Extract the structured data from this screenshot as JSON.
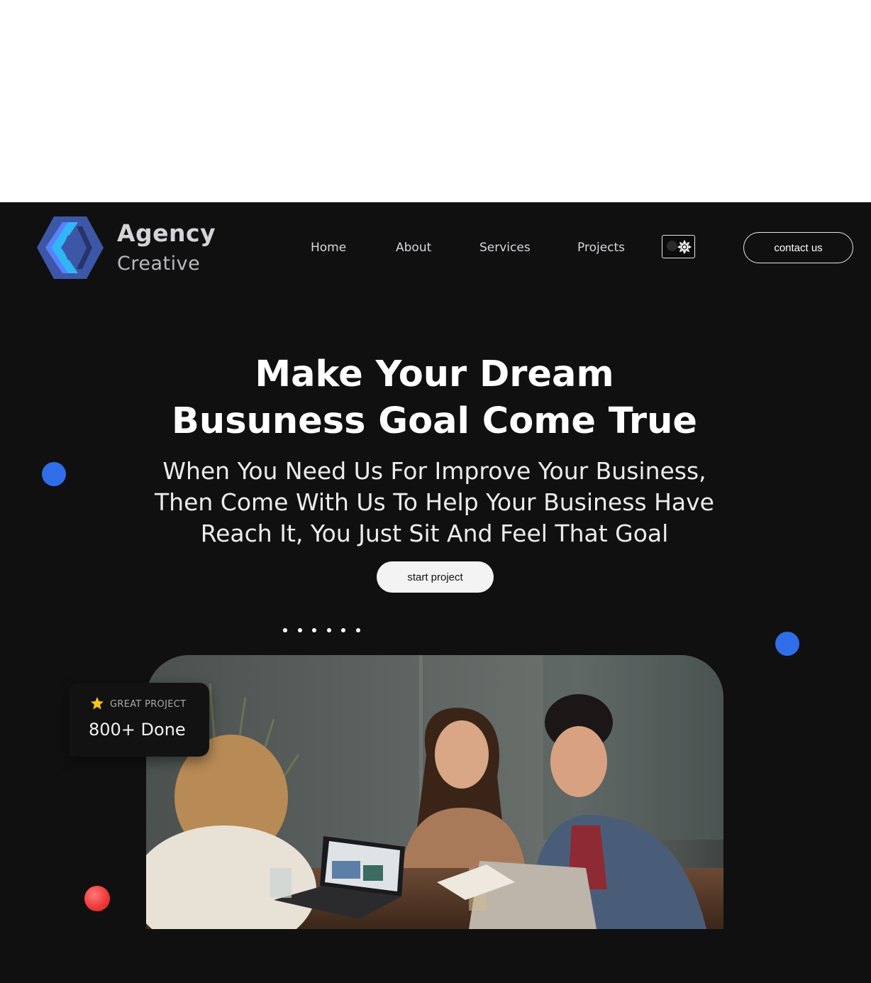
{
  "brand": {
    "title": "Agency",
    "subtitle": "Creative"
  },
  "nav": {
    "items": [
      {
        "label": "Home"
      },
      {
        "label": "About"
      },
      {
        "label": "Services"
      },
      {
        "label": "Projects"
      }
    ],
    "theme_toggle_icons": [
      "moon-icon",
      "sun-icon"
    ],
    "contact_label": "contact us"
  },
  "hero": {
    "title_line1": "Make Your Dream",
    "title_line2": "Busuness Goal Come True",
    "subtitle_line1": "When You Need Us For Improve Your Business,",
    "subtitle_line2": "Then Come With Us To Help Your Business Have",
    "subtitle_line3": "Reach It, You Just Sit And Feel That Goal",
    "cta_label": "start project"
  },
  "badge": {
    "icon": "star-icon",
    "label": "GREAT PROJECT",
    "value": "800+ Done"
  },
  "colors": {
    "background": "#101011",
    "accent_blue": "#2f6ee8",
    "accent_red": "#f03a3a",
    "star": "#f5c518"
  }
}
